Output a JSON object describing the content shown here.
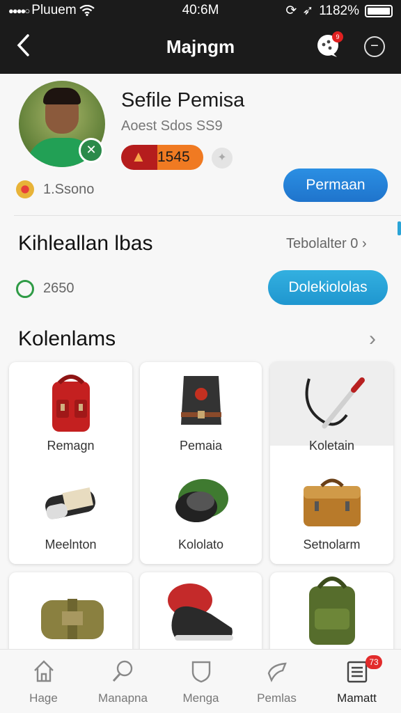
{
  "status_bar": {
    "carrier": "Pluuem",
    "time": "40:6M",
    "battery": "1182%"
  },
  "nav": {
    "title": "Majngm",
    "chat_badge": "9"
  },
  "profile": {
    "name": "Sefile Pemisa",
    "subtitle": "Aoest Sdos SS9",
    "score": "1545",
    "coins": "1.Ssono",
    "primary_button": "Permaan"
  },
  "section1": {
    "title": "Kihleallan lbas",
    "link": "Tebolalter 0",
    "count": "2650",
    "button": "Dolekiololas"
  },
  "section2": {
    "title": "Kolenlams",
    "items": [
      {
        "label": "Remagn",
        "icon": "red-backpack-icon"
      },
      {
        "label": "Pemaia",
        "icon": "vest-icon"
      },
      {
        "label": "Koletain",
        "icon": "whip-knife-icon"
      },
      {
        "label": "Meelnton",
        "icon": "scroll-icon"
      },
      {
        "label": "Kololato",
        "icon": "helmet-icon"
      },
      {
        "label": "Setnolarm",
        "icon": "briefcase-icon"
      },
      {
        "label": "",
        "icon": "canvas-bag-icon"
      },
      {
        "label": "",
        "icon": "sneaker-icon"
      },
      {
        "label": "",
        "icon": "green-backpack-icon"
      }
    ]
  },
  "tab_bar": {
    "tabs": [
      {
        "label": "Hage",
        "icon": "home-icon"
      },
      {
        "label": "Manapna",
        "icon": "search-icon"
      },
      {
        "label": "Menga",
        "icon": "shield-icon"
      },
      {
        "label": "Pemlas",
        "icon": "tag-icon"
      },
      {
        "label": "Mamatt",
        "icon": "list-icon",
        "badge": "73"
      }
    ]
  },
  "colors": {
    "primary_blue": "#1f74cc",
    "teal": "#1f96cf",
    "header_bg": "#1b1b1b",
    "badge_red": "#e22b2b"
  }
}
